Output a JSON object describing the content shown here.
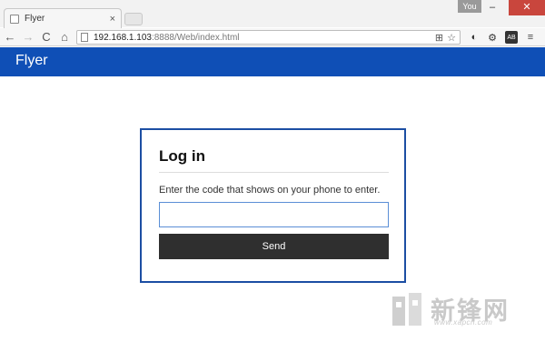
{
  "browser": {
    "tab_title": "Flyer",
    "tab_close": "×",
    "profile_label": "You",
    "window_controls": {
      "minimize": "–",
      "maximize": "□",
      "close": "✕"
    },
    "nav": {
      "back": "←",
      "forward": "→",
      "reload": "C",
      "home": "⌂"
    },
    "url_host": "192.168.1.103",
    "url_rest": ":8888/Web/index.html"
  },
  "app": {
    "brand": "Flyer"
  },
  "login": {
    "title": "Log in",
    "hint": "Enter the code that shows on your phone to enter.",
    "code_value": "",
    "send_label": "Send"
  },
  "watermark": {
    "text": "新锋网",
    "sub": "www.xapcn.com"
  },
  "colors": {
    "appbar": "#0f4fb6",
    "card_border": "#1c4ea3",
    "button_bg": "#2f2f2f"
  }
}
